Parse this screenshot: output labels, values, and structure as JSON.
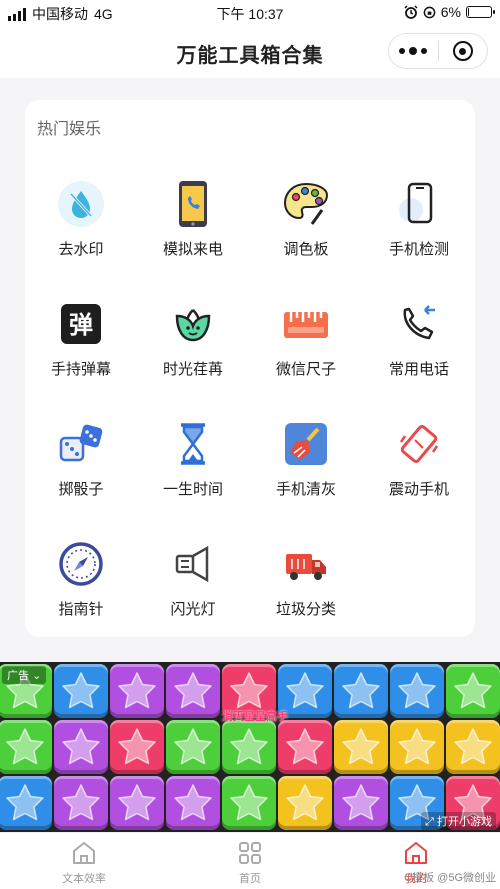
{
  "status_bar": {
    "carrier": "中国移动",
    "network": "4G",
    "time": "下午 10:37",
    "battery": "6%",
    "battery_level": 0.06
  },
  "nav": {
    "title": "万能工具箱合集",
    "more_icon": "more-dots-icon",
    "close_icon": "target-circle-icon"
  },
  "section": {
    "title": "热门娱乐",
    "tools": [
      {
        "label": "去水印",
        "icon": "water-drop-icon"
      },
      {
        "label": "模拟来电",
        "icon": "incoming-call-phone-icon"
      },
      {
        "label": "调色板",
        "icon": "palette-icon"
      },
      {
        "label": "手机检测",
        "icon": "phone-outline-icon"
      },
      {
        "label": "手持弹幕",
        "icon": "danmaku-icon"
      },
      {
        "label": "时光荏苒",
        "icon": "plant-face-icon"
      },
      {
        "label": "微信尺子",
        "icon": "ruler-icon"
      },
      {
        "label": "常用电话",
        "icon": "phone-callback-icon"
      },
      {
        "label": "掷骰子",
        "icon": "dice-icon"
      },
      {
        "label": "一生时间",
        "icon": "hourglass-icon"
      },
      {
        "label": "手机清灰",
        "icon": "broom-icon"
      },
      {
        "label": "震动手机",
        "icon": "vibrate-phone-icon"
      },
      {
        "label": "指南针",
        "icon": "compass-icon"
      },
      {
        "label": "闪光灯",
        "icon": "flashlight-icon"
      },
      {
        "label": "垃圾分类",
        "icon": "garbage-truck-icon"
      }
    ]
  },
  "ad": {
    "tag": "广告",
    "caption": "消灭星星高手",
    "open_label": "打开小游戏",
    "tile_colors": [
      [
        "#4ccf3a",
        "#2f8fe8",
        "#b04fe0",
        "#b04fe0",
        "#ef3d6a",
        "#2f8fe8",
        "#2f8fe8",
        "#2f8fe8",
        "#4ccf3a"
      ],
      [
        "#4ccf3a",
        "#b04fe0",
        "#ef3d6a",
        "#4ccf3a",
        "#4ccf3a",
        "#ef3d6a",
        "#f3c21e",
        "#f3c21e",
        "#f3c21e"
      ],
      [
        "#2f8fe8",
        "#b04fe0",
        "#b04fe0",
        "#b04fe0",
        "#4ccf3a",
        "#f3c21e",
        "#b04fe0",
        "#2f8fe8",
        "#ef3d6a"
      ]
    ]
  },
  "tab_bar": {
    "tabs": [
      {
        "label": "文本效率",
        "icon": "home-icon"
      },
      {
        "label": "首页",
        "icon": "grid-icon"
      },
      {
        "label": "我的",
        "icon": "home-icon"
      }
    ],
    "watermark": "C模板 @5G微创业"
  }
}
